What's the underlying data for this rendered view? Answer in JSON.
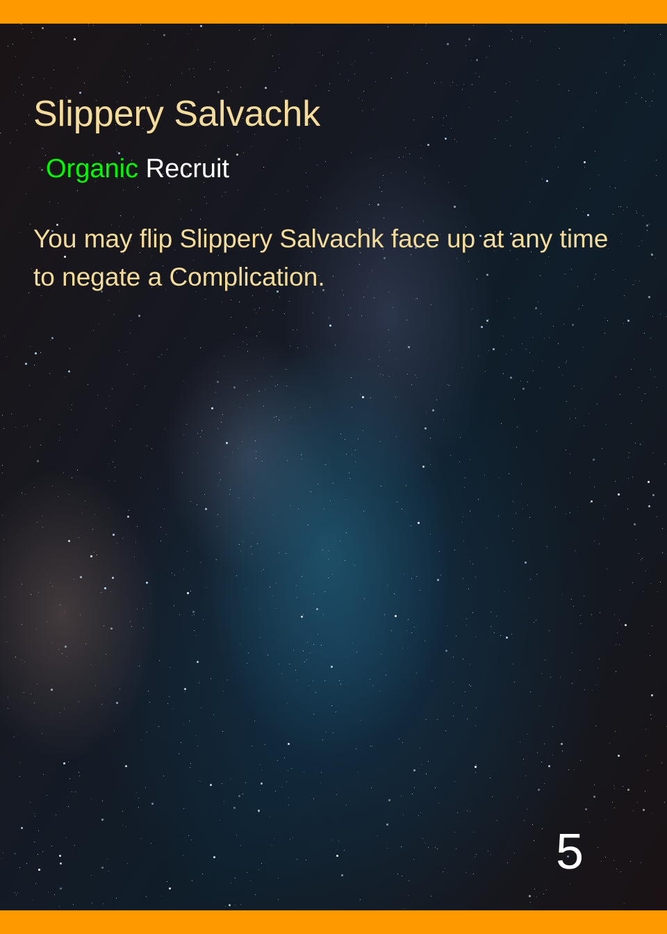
{
  "card": {
    "name": "Slippery Salvachk",
    "faction": "Organic",
    "type": "Recruit",
    "ability": "You may flip Slippery Salvachk face up at any time to negate a Complication.",
    "cost": "5"
  },
  "colors": {
    "border": "#ff9900",
    "title": "#f5dc9a",
    "faction": "#00ff00",
    "type": "#ffffff",
    "cost": "#ffffff"
  }
}
